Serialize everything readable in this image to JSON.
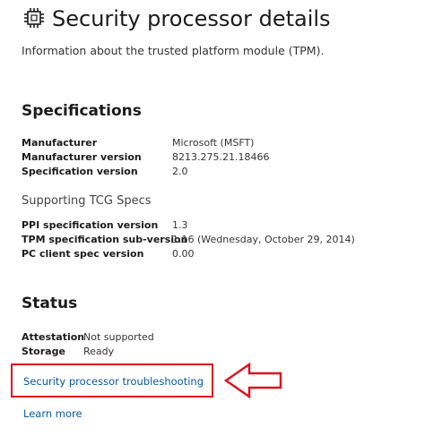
{
  "header": {
    "icon": "chip-icon",
    "title": "Security processor details",
    "subtitle": "Information about the trusted platform module (TPM)."
  },
  "specifications": {
    "heading": "Specifications",
    "rows": [
      {
        "label": "Manufacturer",
        "value": "Microsoft (MSFT)"
      },
      {
        "label": "Manufacturer version",
        "value": "8213.275.21.18466"
      },
      {
        "label": "Specification version",
        "value": "2.0"
      }
    ]
  },
  "tcg": {
    "heading": "Supporting TCG Specs",
    "rows": [
      {
        "label": "PPI specification version",
        "value": "1.3"
      },
      {
        "label": "TPM specification sub-version",
        "value": "1.16 (Wednesday, October 29, 2014)"
      },
      {
        "label": "PC client spec version",
        "value": "0.00"
      }
    ]
  },
  "status": {
    "heading": "Status",
    "rows": [
      {
        "label": "Attestation",
        "value": "Not supported"
      },
      {
        "label": "Storage",
        "value": "Ready"
      }
    ]
  },
  "links": {
    "troubleshooting": "Security processor troubleshooting",
    "learn_more": "Learn more"
  },
  "colors": {
    "link": "#0a57a6",
    "highlight": "#e0121f"
  }
}
